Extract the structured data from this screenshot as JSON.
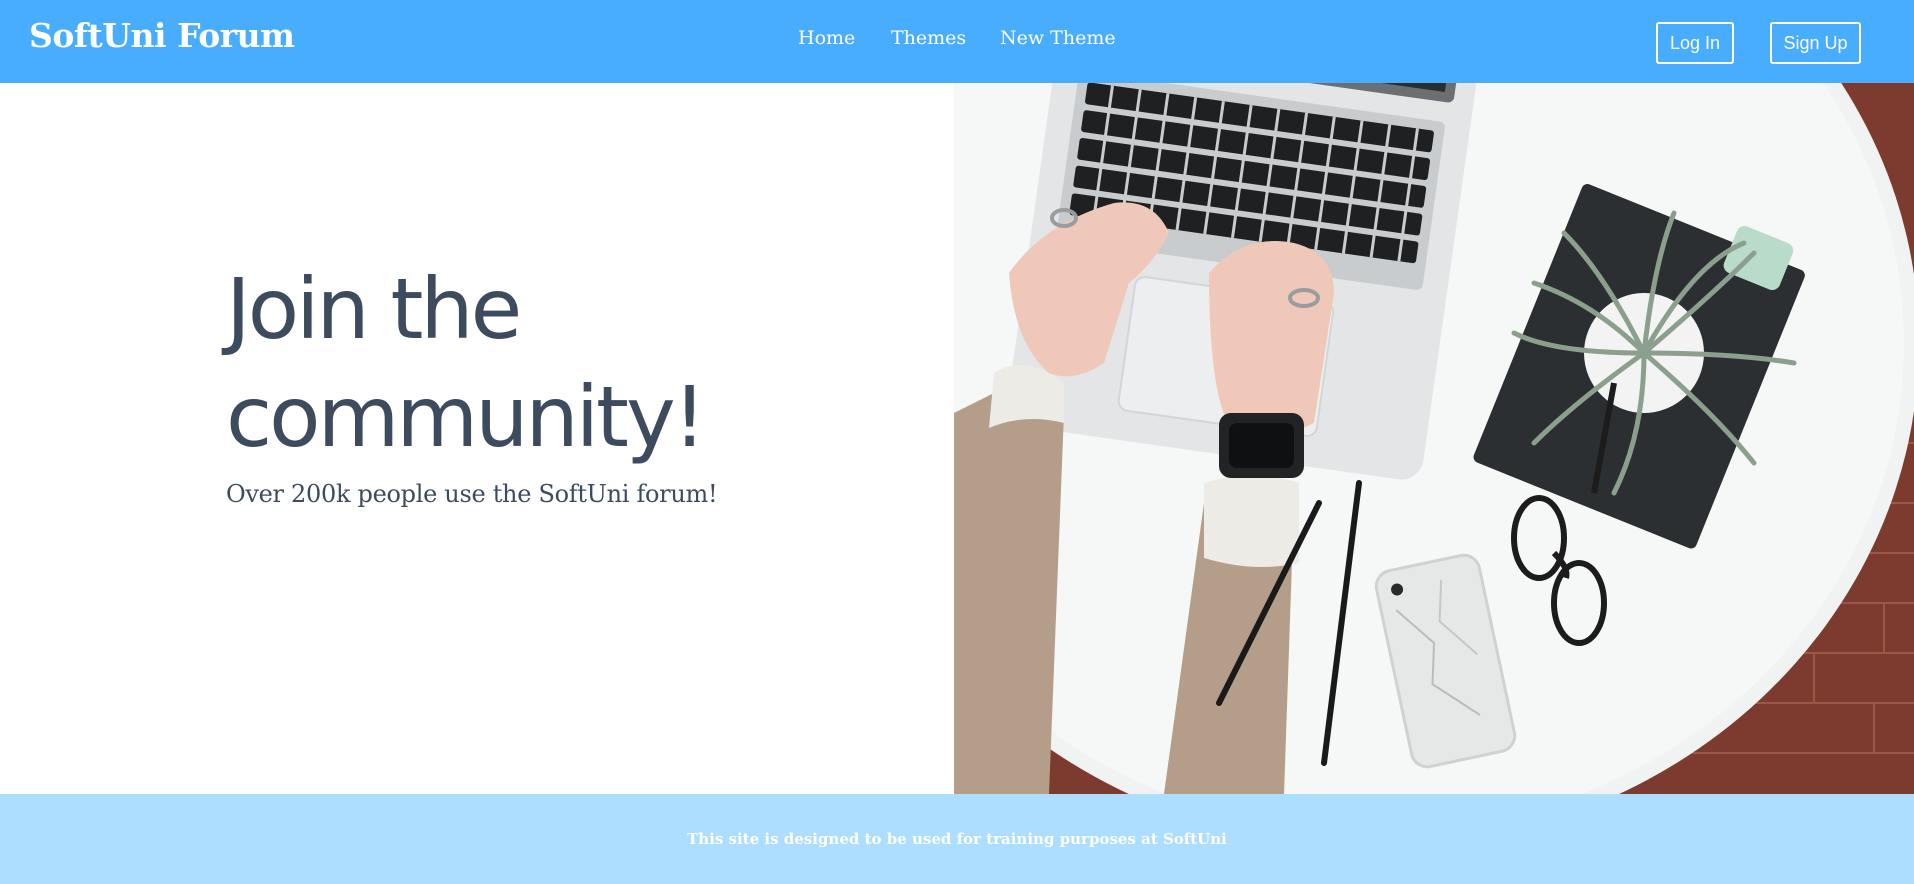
{
  "header": {
    "brand": "SoftUni Forum",
    "nav": {
      "home": "Home",
      "themes": "Themes",
      "new_theme": "New Theme"
    },
    "auth": {
      "login": "Log In",
      "signup": "Sign Up"
    }
  },
  "hero": {
    "title": "Join the community!",
    "subtitle": "Over 200k people use the SoftUni forum!",
    "image": "laptop-desk-photo"
  },
  "footer": {
    "text": "This site is designed to be used for training purposes at SoftUni"
  },
  "colors": {
    "header_bg": "#48adff",
    "footer_bg": "#addeff",
    "heading_text": "#3d4b5f",
    "light_text": "#ffffff"
  }
}
